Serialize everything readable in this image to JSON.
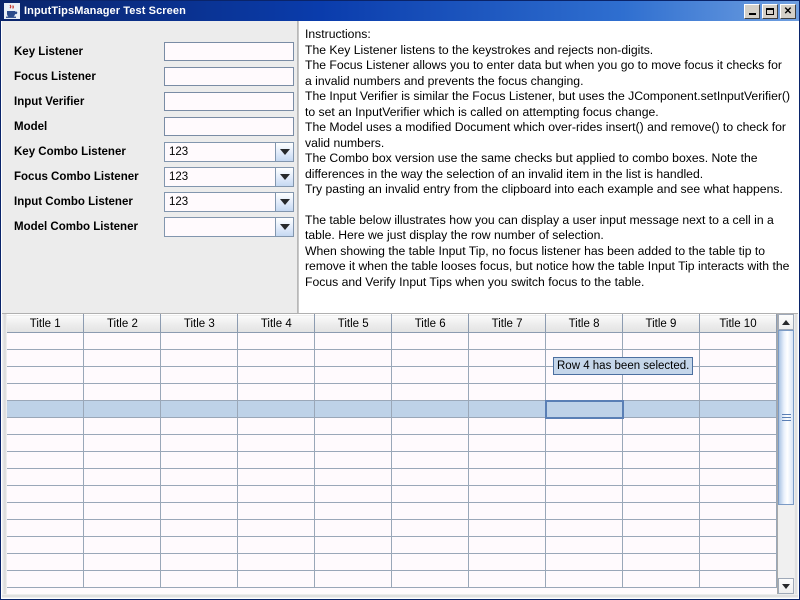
{
  "window": {
    "title": "InputTipsManager Test Screen",
    "icon": "java-coffee-cup-icon",
    "buttons": {
      "minimize": "_",
      "maximize": "□",
      "close": "✕"
    },
    "colors": {
      "titlebar_start": "#0a246a",
      "titlebar_end": "#6f9fe0",
      "panel_bg": "#ececec",
      "field_bg": "#fffafd",
      "field_border": "#7a8ca5",
      "selection": "#bed2e8",
      "tooltip_bg": "#c5d6ea",
      "tooltip_border": "#4c6fa0"
    }
  },
  "form": {
    "rows": [
      {
        "label": "Key Listener",
        "type": "text",
        "value": ""
      },
      {
        "label": "Focus Listener",
        "type": "text",
        "value": ""
      },
      {
        "label": "Input Verifier",
        "type": "text",
        "value": ""
      },
      {
        "label": "Model",
        "type": "text",
        "value": ""
      },
      {
        "label": "Key Combo Listener",
        "type": "combo",
        "value": "123"
      },
      {
        "label": "Focus Combo Listener",
        "type": "combo",
        "value": "123"
      },
      {
        "label": "Input Combo Listener",
        "type": "combo",
        "value": "123"
      },
      {
        "label": "Model Combo Listener",
        "type": "combo",
        "value": ""
      }
    ]
  },
  "instructions": {
    "heading": "Instructions:",
    "paragraphs": [
      "The Key Listener  listens to the keystrokes and rejects non-digits.",
      "The Focus Listener  allows you to enter data but when you go to move focus it checks for a invalid numbers and prevents the focus changing.",
      "The Input Verifier is similar the Focus Listener, but uses the JComponent.setInputVerifier() to set an InputVerifier which is called on attempting focus change.",
      "The Model uses a modified Document which over-rides insert() and remove() to check for valid numbers.",
      "The Combo box version use the same checks but applied to combo boxes. Note the differences in the way the selection of an invalid item in the list is handled.",
      "Try pasting an invalid entry from the clipboard into each example and see what happens."
    ],
    "paragraphs2": [
      "The table below illustrates how you can display a user input message next to a cell in a table. Here we just display the row number of selection.",
      "When showing the table Input Tip, no focus listener has been added to the table tip to remove it when the table looses focus, but notice how the table Input Tip interacts with the Focus and Verify Input Tips when you switch focus to the table."
    ]
  },
  "table": {
    "headers": [
      "Title 1",
      "Title 2",
      "Title 3",
      "Title 4",
      "Title 5",
      "Title 6",
      "Title 7",
      "Title 8",
      "Title 9",
      "Title 10"
    ],
    "row_count": 15,
    "selected_row_index": 4,
    "selected_column_index": 7,
    "cells_empty": true,
    "input_tip": "Row 4 has been selected."
  },
  "scrollbar": {
    "up_arrow": "▲",
    "down_arrow": "▼",
    "orientation": "vertical"
  }
}
